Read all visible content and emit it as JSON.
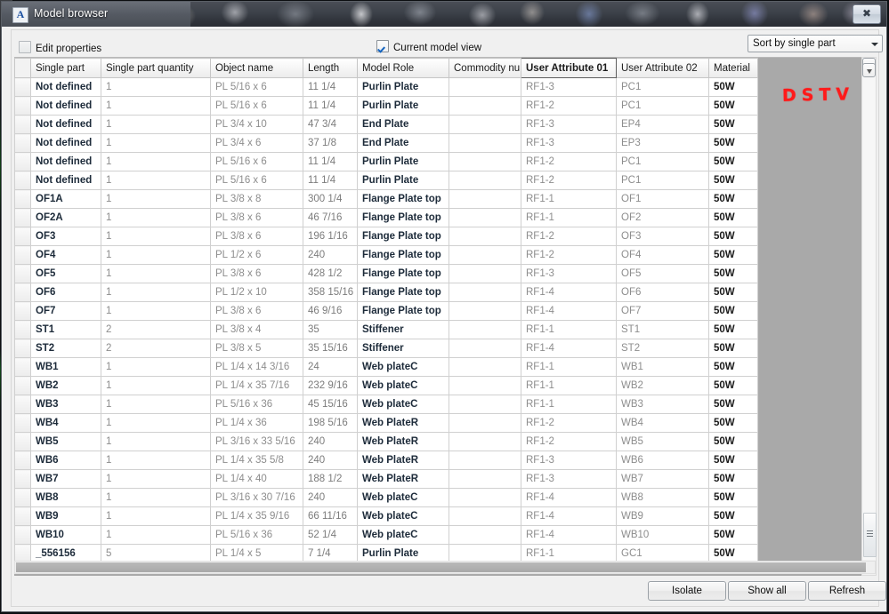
{
  "window": {
    "title": "Model browser",
    "app_icon": "A",
    "close_label": "✖"
  },
  "toolbar": {
    "edit_properties_label": "Edit properties",
    "edit_properties_checked": false,
    "current_model_view_label": "Current model view",
    "current_model_view_checked": true,
    "sort_combo_value": "Sort by single part"
  },
  "annotation": {
    "dstv_text": "DSTV",
    "dstv_color": "#ff1a1a"
  },
  "grid": {
    "columns": [
      "",
      "Single part",
      "Single part quantity",
      "Object name",
      "Length",
      "Model Role",
      "Commodity nu",
      "User Attribute 01",
      "User Attribute 02",
      "Material"
    ],
    "sorted_column": "User Attribute 01",
    "rows": [
      {
        "single_part": "Not defined",
        "qty": "1",
        "object_name": "PL 5/16 x 6",
        "length": "11 1/4",
        "model_role": "Purlin Plate",
        "commodity": "",
        "ua01": "RF1-3",
        "ua02": "PC1",
        "material": "50W"
      },
      {
        "single_part": "Not defined",
        "qty": "1",
        "object_name": "PL 5/16 x 6",
        "length": "11 1/4",
        "model_role": "Purlin Plate",
        "commodity": "",
        "ua01": "RF1-2",
        "ua02": "PC1",
        "material": "50W"
      },
      {
        "single_part": "Not defined",
        "qty": "1",
        "object_name": "PL 3/4 x 10",
        "length": "47 3/4",
        "model_role": "End Plate",
        "commodity": "",
        "ua01": "RF1-3",
        "ua02": "EP4",
        "material": "50W"
      },
      {
        "single_part": "Not defined",
        "qty": "1",
        "object_name": "PL 3/4 x 6",
        "length": "37 1/8",
        "model_role": "End Plate",
        "commodity": "",
        "ua01": "RF1-3",
        "ua02": "EP3",
        "material": "50W"
      },
      {
        "single_part": "Not defined",
        "qty": "1",
        "object_name": "PL 5/16 x 6",
        "length": "11 1/4",
        "model_role": "Purlin Plate",
        "commodity": "",
        "ua01": "RF1-2",
        "ua02": "PC1",
        "material": "50W"
      },
      {
        "single_part": "Not defined",
        "qty": "1",
        "object_name": "PL 5/16 x 6",
        "length": "11 1/4",
        "model_role": "Purlin Plate",
        "commodity": "",
        "ua01": "RF1-2",
        "ua02": "PC1",
        "material": "50W"
      },
      {
        "single_part": "OF1A",
        "qty": "1",
        "object_name": "PL 3/8 x 8",
        "length": "300 1/4",
        "model_role": "Flange Plate top",
        "commodity": "",
        "ua01": "RF1-1",
        "ua02": "OF1",
        "material": "50W"
      },
      {
        "single_part": "OF2A",
        "qty": "1",
        "object_name": "PL 3/8 x 6",
        "length": "46 7/16",
        "model_role": "Flange Plate top",
        "commodity": "",
        "ua01": "RF1-1",
        "ua02": "OF2",
        "material": "50W"
      },
      {
        "single_part": "OF3",
        "qty": "1",
        "object_name": "PL 3/8 x 6",
        "length": "196 1/16",
        "model_role": "Flange Plate top",
        "commodity": "",
        "ua01": "RF1-2",
        "ua02": "OF3",
        "material": "50W"
      },
      {
        "single_part": "OF4",
        "qty": "1",
        "object_name": "PL 1/2 x 6",
        "length": "240",
        "model_role": "Flange Plate top",
        "commodity": "",
        "ua01": "RF1-2",
        "ua02": "OF4",
        "material": "50W"
      },
      {
        "single_part": "OF5",
        "qty": "1",
        "object_name": "PL 3/8 x 6",
        "length": "428 1/2",
        "model_role": "Flange Plate top",
        "commodity": "",
        "ua01": "RF1-3",
        "ua02": "OF5",
        "material": "50W"
      },
      {
        "single_part": "OF6",
        "qty": "1",
        "object_name": "PL 1/2 x 10",
        "length": "358 15/16",
        "model_role": "Flange Plate top",
        "commodity": "",
        "ua01": "RF1-4",
        "ua02": "OF6",
        "material": "50W"
      },
      {
        "single_part": "OF7",
        "qty": "1",
        "object_name": "PL 3/8 x 6",
        "length": "46 9/16",
        "model_role": "Flange Plate top",
        "commodity": "",
        "ua01": "RF1-4",
        "ua02": "OF7",
        "material": "50W"
      },
      {
        "single_part": "ST1",
        "qty": "2",
        "object_name": "PL 3/8 x 4",
        "length": "35",
        "model_role": "Stiffener",
        "commodity": "",
        "ua01": "RF1-1",
        "ua02": "ST1",
        "material": "50W"
      },
      {
        "single_part": "ST2",
        "qty": "2",
        "object_name": "PL 3/8 x 5",
        "length": "35 15/16",
        "model_role": "Stiffener",
        "commodity": "",
        "ua01": "RF1-4",
        "ua02": "ST2",
        "material": "50W"
      },
      {
        "single_part": "WB1",
        "qty": "1",
        "object_name": "PL 1/4 x 14 3/16",
        "length": "24",
        "model_role": "Web plateC",
        "commodity": "",
        "ua01": "RF1-1",
        "ua02": "WB1",
        "material": "50W"
      },
      {
        "single_part": "WB2",
        "qty": "1",
        "object_name": "PL 1/4 x 35 7/16",
        "length": "232 9/16",
        "model_role": "Web plateC",
        "commodity": "",
        "ua01": "RF1-1",
        "ua02": "WB2",
        "material": "50W"
      },
      {
        "single_part": "WB3",
        "qty": "1",
        "object_name": "PL 5/16 x 36",
        "length": "45 15/16",
        "model_role": "Web plateC",
        "commodity": "",
        "ua01": "RF1-1",
        "ua02": "WB3",
        "material": "50W"
      },
      {
        "single_part": "WB4",
        "qty": "1",
        "object_name": "PL 1/4 x 36",
        "length": "198 5/16",
        "model_role": "Web PlateR",
        "commodity": "",
        "ua01": "RF1-2",
        "ua02": "WB4",
        "material": "50W"
      },
      {
        "single_part": "WB5",
        "qty": "1",
        "object_name": "PL 3/16 x 33 5/16",
        "length": "240",
        "model_role": "Web PlateR",
        "commodity": "",
        "ua01": "RF1-2",
        "ua02": "WB5",
        "material": "50W"
      },
      {
        "single_part": "WB6",
        "qty": "1",
        "object_name": "PL 1/4 x 35 5/8",
        "length": "240",
        "model_role": "Web PlateR",
        "commodity": "",
        "ua01": "RF1-3",
        "ua02": "WB6",
        "material": "50W"
      },
      {
        "single_part": "WB7",
        "qty": "1",
        "object_name": "PL 1/4 x 40",
        "length": "188 1/2",
        "model_role": "Web PlateR",
        "commodity": "",
        "ua01": "RF1-3",
        "ua02": "WB7",
        "material": "50W"
      },
      {
        "single_part": "WB8",
        "qty": "1",
        "object_name": "PL 3/16 x 30 7/16",
        "length": "240",
        "model_role": "Web plateC",
        "commodity": "",
        "ua01": "RF1-4",
        "ua02": "WB8",
        "material": "50W"
      },
      {
        "single_part": "WB9",
        "qty": "1",
        "object_name": "PL 1/4 x 35 9/16",
        "length": "66 11/16",
        "model_role": "Web plateC",
        "commodity": "",
        "ua01": "RF1-4",
        "ua02": "WB9",
        "material": "50W"
      },
      {
        "single_part": "WB10",
        "qty": "1",
        "object_name": "PL 5/16 x 36",
        "length": "52 1/4",
        "model_role": "Web plateC",
        "commodity": "",
        "ua01": "RF1-4",
        "ua02": "WB10",
        "material": "50W"
      },
      {
        "single_part": "_556156",
        "qty": "5",
        "object_name": "PL 1/4 x 5",
        "length": "7 1/4",
        "model_role": "Purlin Plate",
        "commodity": "",
        "ua01": "RF1-1",
        "ua02": "GC1",
        "material": "50W"
      }
    ]
  },
  "footer": {
    "isolate_label": "Isolate",
    "show_all_label": "Show all",
    "refresh_label": "Refresh"
  }
}
